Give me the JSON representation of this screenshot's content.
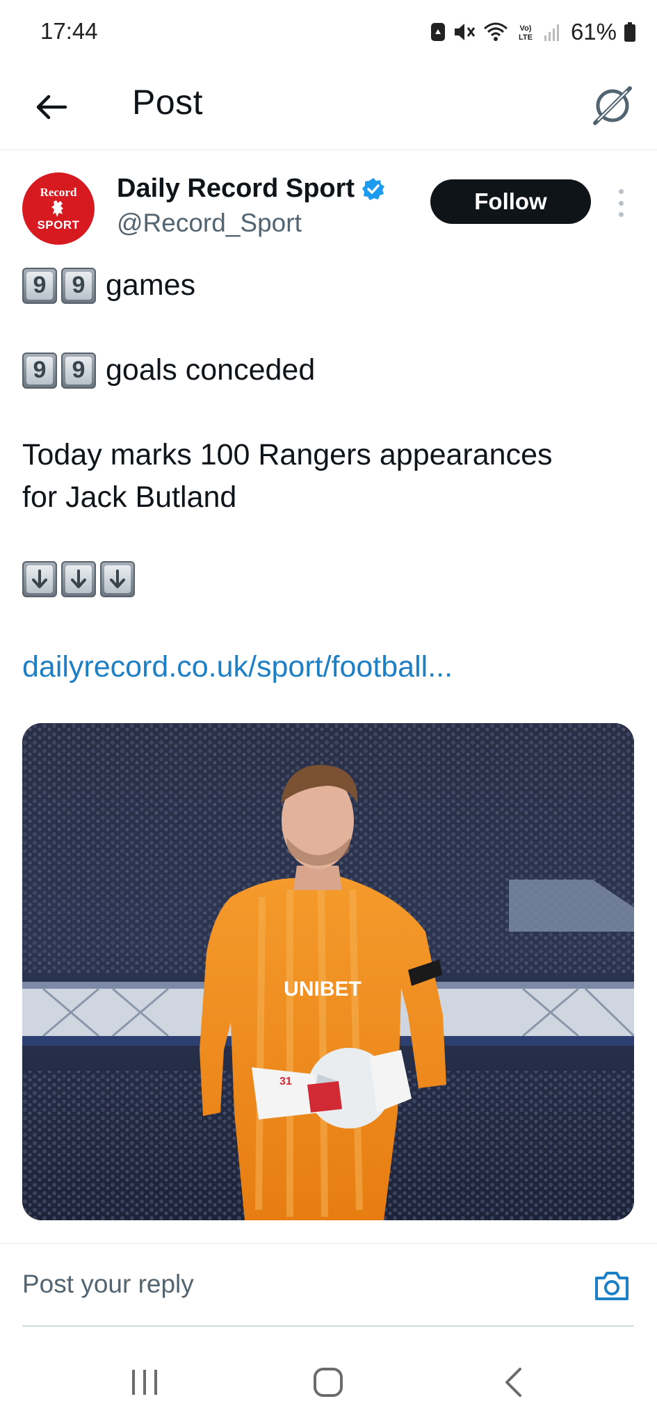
{
  "status_bar": {
    "time": "17:44",
    "battery_percent": "61%",
    "volte_label": "Vo) LTE",
    "icons": [
      "lock-badge-icon",
      "mute-icon",
      "wifi-icon",
      "volte-icon",
      "signal-icon",
      "battery-icon"
    ]
  },
  "header": {
    "title": "Post",
    "back_icon": "arrow-left-icon",
    "grok_icon": "grok-icon"
  },
  "author": {
    "name": "Daily Record Sport",
    "handle": "@Record_Sport",
    "verified": true,
    "follow_label": "Follow",
    "avatar_top": "Record",
    "avatar_bottom": "SPORT"
  },
  "tweet": {
    "line1_digits": [
      "9",
      "9"
    ],
    "line1_text": "games",
    "line2_digits": [
      "9",
      "9"
    ],
    "line2_text": "goals conceded",
    "line3_text": "Today marks 100 Rangers appearances",
    "line4_text": "for Jack Butland",
    "arrows": [
      "down-arrow-icon",
      "down-arrow-icon",
      "down-arrow-icon"
    ],
    "link": "dailyrecord.co.uk/sport/football...",
    "image_shirt_text": "UNIBET",
    "image_number": "31"
  },
  "reply": {
    "placeholder": "Post your reply",
    "camera_icon": "camera-icon"
  },
  "nav": {
    "icons": [
      "recents-icon",
      "home-icon",
      "back-icon"
    ]
  },
  "colors": {
    "link": "#1d7fc6",
    "verified": "#1d9bf0",
    "avatar_bg": "#d71a20",
    "follow_bg": "#0f1419"
  }
}
